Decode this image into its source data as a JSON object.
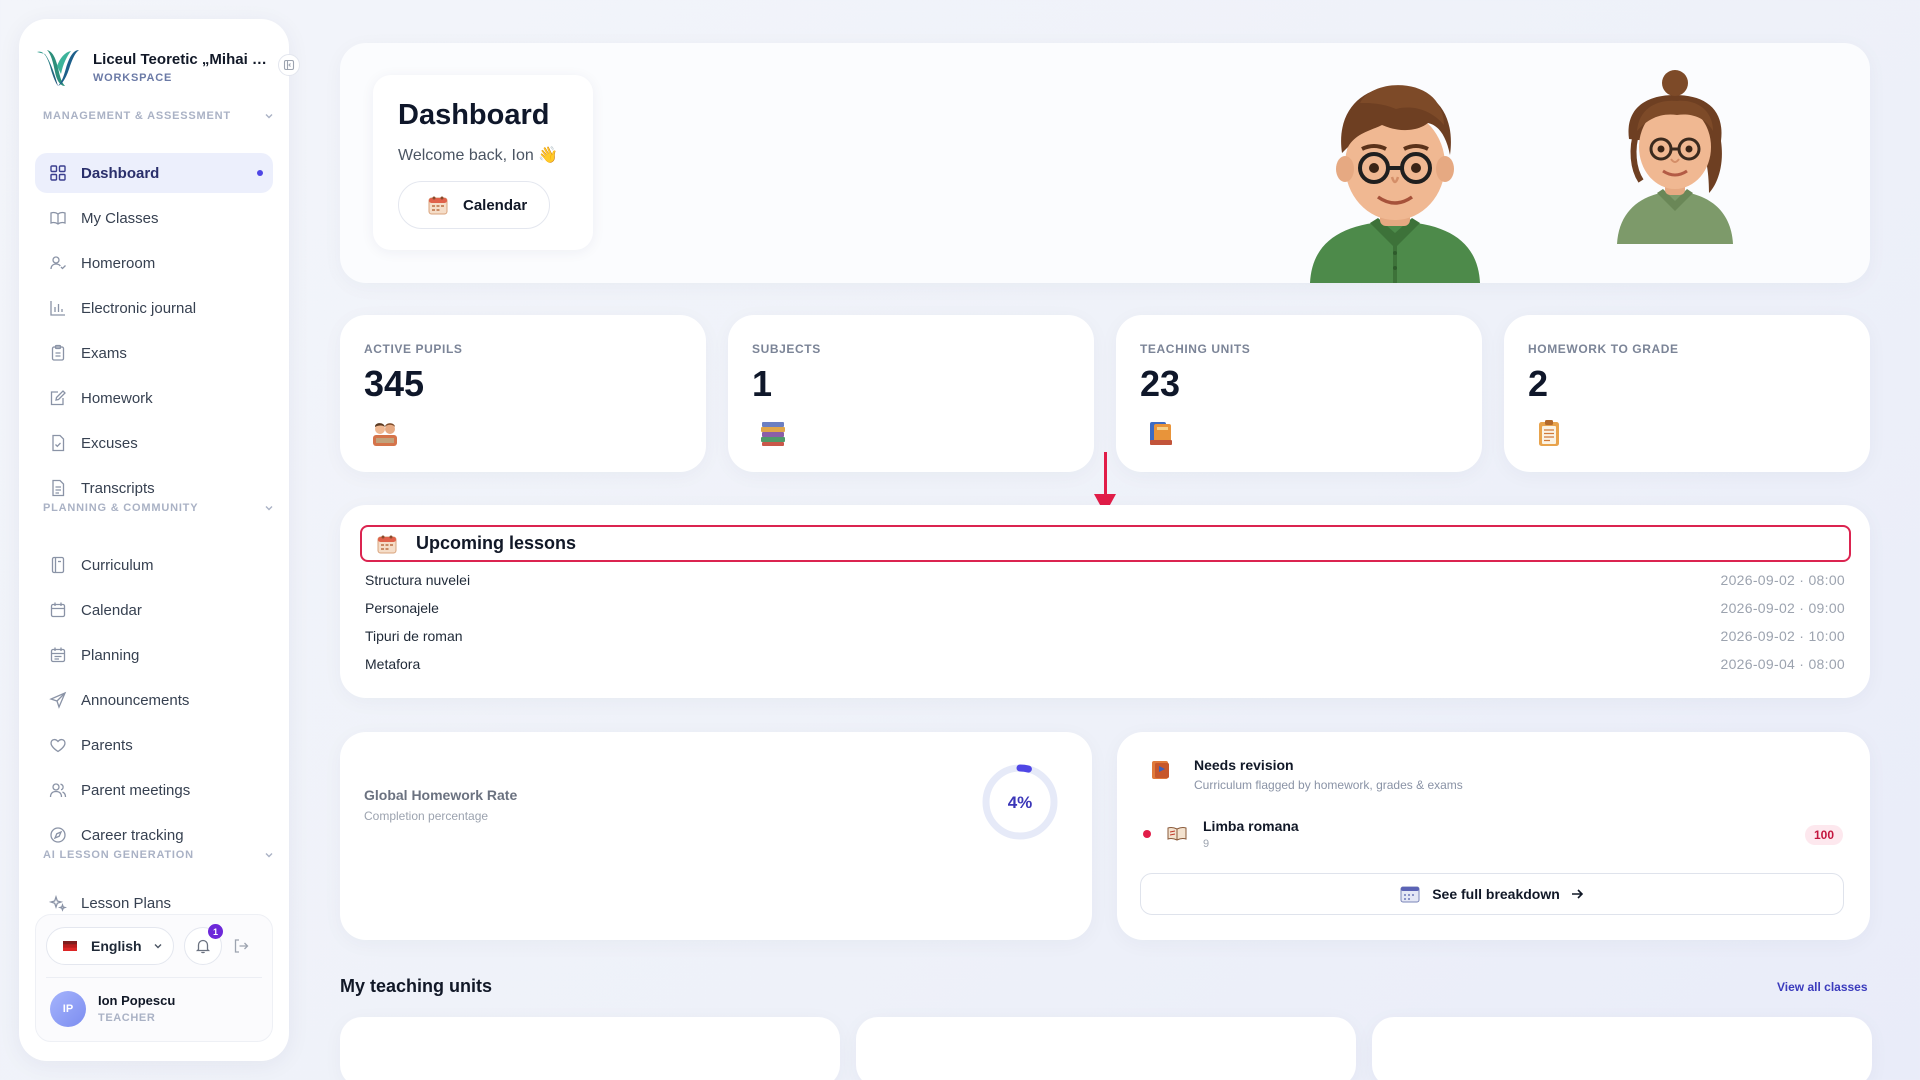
{
  "workspace": {
    "name": "Liceul Teoretic „Mihai Emi...",
    "label": "WORKSPACE"
  },
  "sidebar": {
    "sections": [
      {
        "title": "MANAGEMENT & ASSESSMENT"
      },
      {
        "title": "PLANNING & COMMUNITY"
      },
      {
        "title": "AI LESSON GENERATION"
      }
    ],
    "items": [
      {
        "label": "Dashboard",
        "icon": "grid-icon",
        "active": true
      },
      {
        "label": "My Classes",
        "icon": "book-open-icon"
      },
      {
        "label": "Homeroom",
        "icon": "user-check-icon"
      },
      {
        "label": "Electronic journal",
        "icon": "bar-chart-icon"
      },
      {
        "label": "Exams",
        "icon": "clipboard-icon"
      },
      {
        "label": "Homework",
        "icon": "edit-note-icon"
      },
      {
        "label": "Excuses",
        "icon": "file-check-icon"
      },
      {
        "label": "Transcripts",
        "icon": "file-text-icon"
      },
      {
        "label": "Curriculum",
        "icon": "notebook-icon"
      },
      {
        "label": "Calendar",
        "icon": "calendar-icon"
      },
      {
        "label": "Planning",
        "icon": "calendar-list-icon"
      },
      {
        "label": "Announcements",
        "icon": "send-icon"
      },
      {
        "label": "Parents",
        "icon": "heart-icon"
      },
      {
        "label": "Parent meetings",
        "icon": "users-icon"
      },
      {
        "label": "Career tracking",
        "icon": "compass-icon"
      },
      {
        "label": "Lesson Plans",
        "icon": "sparkles-icon"
      }
    ]
  },
  "footer": {
    "language": "English",
    "notifications_count": "1",
    "user": {
      "initials": "IP",
      "name": "Ion Popescu",
      "role": "TEACHER"
    }
  },
  "hero": {
    "title": "Dashboard",
    "subtitle": "Welcome back, Ion 👋",
    "calendar_button": "Calendar"
  },
  "stats": [
    {
      "label": "ACTIVE PUPILS",
      "value": "345",
      "icon": "pupils-emoji-icon"
    },
    {
      "label": "SUBJECTS",
      "value": "1",
      "icon": "books-stack-icon"
    },
    {
      "label": "TEACHING UNITS",
      "value": "23",
      "icon": "books-icon"
    },
    {
      "label": "HOMEWORK TO GRADE",
      "value": "2",
      "icon": "clipboard-emoji-icon"
    }
  ],
  "lessons": {
    "title": "Upcoming lessons",
    "items": [
      {
        "name": "Structura nuvelei",
        "time": "2026-09-02 · 08:00"
      },
      {
        "name": "Personajele",
        "time": "2026-09-02 · 09:00"
      },
      {
        "name": "Tipuri de roman",
        "time": "2026-09-02 · 10:00"
      },
      {
        "name": "Metafora",
        "time": "2026-09-04 · 08:00"
      }
    ]
  },
  "homework_rate": {
    "title": "Global Homework Rate",
    "subtitle": "Completion percentage",
    "value_label": "4%",
    "value": 0.04
  },
  "revision": {
    "title": "Needs revision",
    "subtitle": "Curriculum flagged by homework, grades & exams",
    "items": [
      {
        "name": "Limba romana",
        "sub": "9",
        "score": "100"
      }
    ],
    "button": "See full breakdown"
  },
  "units": {
    "title": "My teaching units",
    "link": "View all classes"
  },
  "colors": {
    "accent": "#4f46e5",
    "highlight": "#e11d48",
    "active_bg": "#eceffc"
  }
}
